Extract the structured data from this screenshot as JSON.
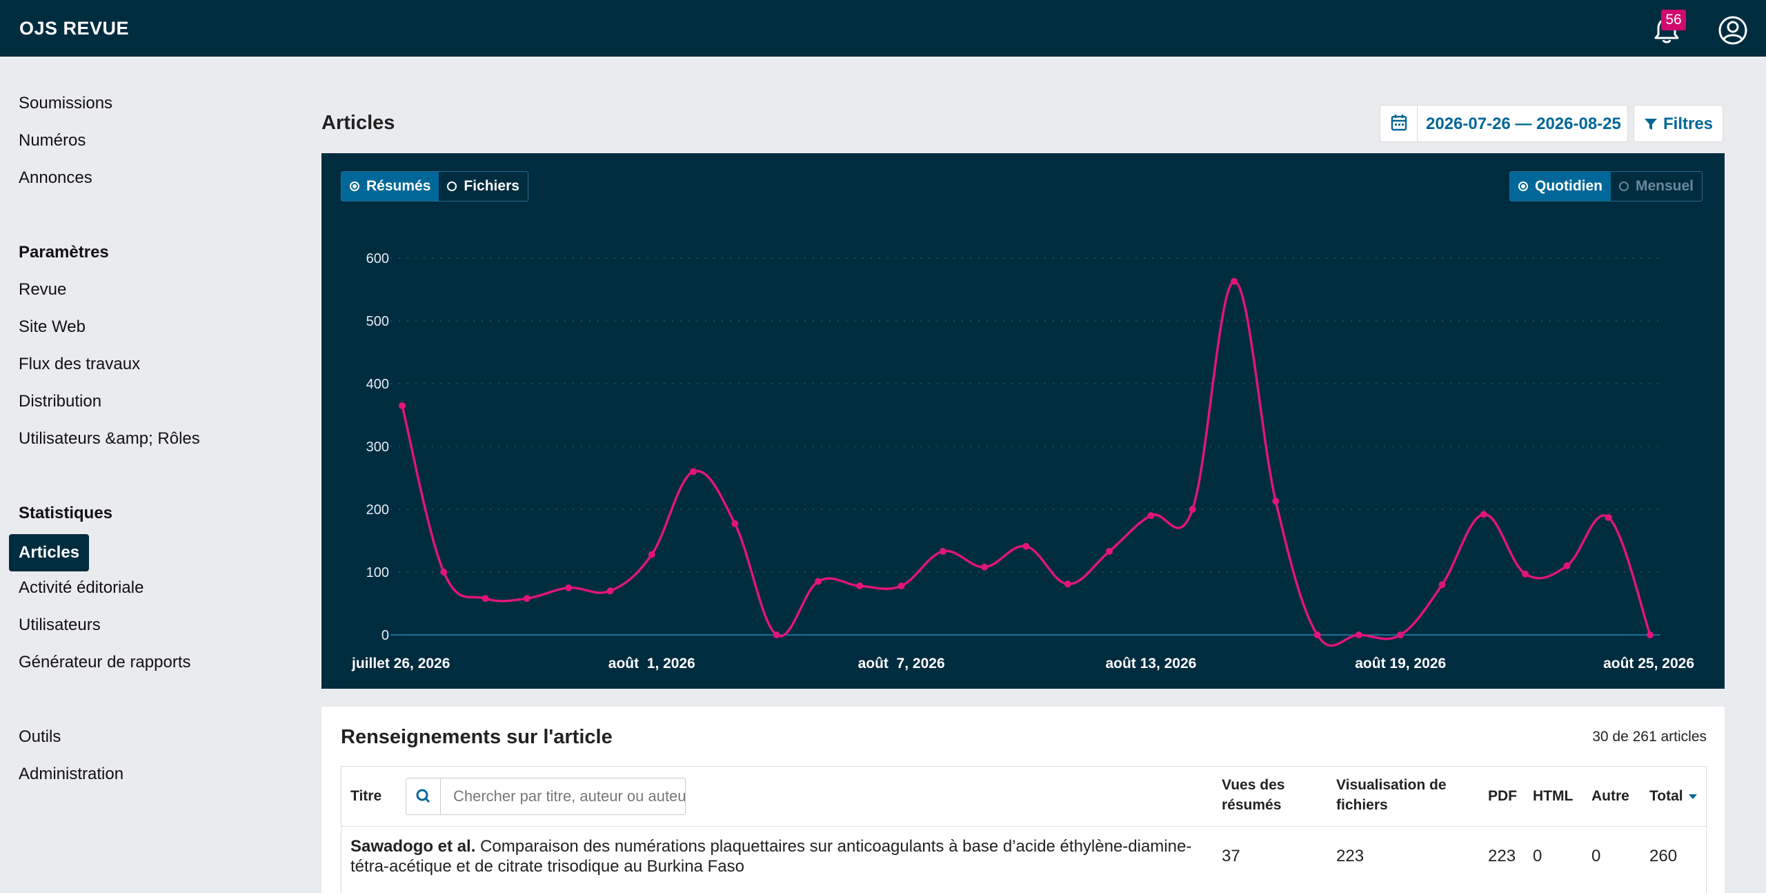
{
  "app": {
    "title": "OJS REVUE",
    "notifications_count": "56"
  },
  "sidebar": {
    "group1": [
      "Soumissions",
      "Numéros",
      "Annonces"
    ],
    "settings_heading": "Paramètres",
    "settings_items": [
      "Revue",
      "Site Web",
      "Flux des travaux",
      "Distribution",
      "Utilisateurs &amp; Rôles"
    ],
    "stats_heading": "Statistiques",
    "stats_active": "Articles",
    "stats_items": [
      "Activité éditoriale",
      "Utilisateurs",
      "Générateur de rapports"
    ],
    "tools_items": [
      "Outils",
      "Administration"
    ]
  },
  "main": {
    "title": "Articles",
    "date_range": "2026-07-26 — 2026-08-25",
    "filters_label": "Filtres"
  },
  "chart_toggles": {
    "left": [
      {
        "label": "Résumés",
        "active": true
      },
      {
        "label": "Fichiers",
        "active": false
      }
    ],
    "right": [
      {
        "label": "Quotidien",
        "active": true
      },
      {
        "label": "Mensuel",
        "active": false
      }
    ]
  },
  "chart_data": {
    "type": "line",
    "x_ticks": [
      "juillet 26, 2026",
      "août  1, 2026",
      "août  7, 2026",
      "août 13, 2026",
      "août 19, 2026",
      "août 25, 2026"
    ],
    "x_tick_index": [
      0,
      6,
      12,
      18,
      24,
      30
    ],
    "y_ticks": [
      "0",
      "100",
      "200",
      "300",
      "400",
      "500",
      "600"
    ],
    "ylim": [
      0,
      600
    ],
    "grid": true,
    "series": [
      {
        "color": "#e0157a",
        "values": [
          365,
          100,
          58,
          58,
          75,
          70,
          128,
          260,
          177,
          0,
          85,
          78,
          78,
          133,
          108,
          141,
          81,
          133,
          190,
          200,
          563,
          213,
          0,
          0,
          0,
          80,
          192,
          97,
          110,
          187,
          0
        ]
      }
    ]
  },
  "details": {
    "title": "Renseignements sur l'article",
    "count": "30 de 261 articles",
    "columns": {
      "title": "Titre",
      "abstract_views": "Vues des résumés",
      "file_views": "Visualisation de fichiers",
      "pdf": "PDF",
      "html": "HTML",
      "other": "Autre",
      "total": "Total"
    },
    "search_placeholder": "Chercher par titre, auteur ou auteur",
    "rows": [
      {
        "authors": "Sawadogo et al.",
        "title": "Comparaison des numérations plaquettaires sur anticoagulants à base d’acide éthylène-diamine-tétra-acétique et de citrate trisodique au Burkina Faso",
        "abstract_views": "37",
        "file_views": "223",
        "pdf": "223",
        "html": "0",
        "other": "0",
        "total": "260"
      }
    ]
  }
}
